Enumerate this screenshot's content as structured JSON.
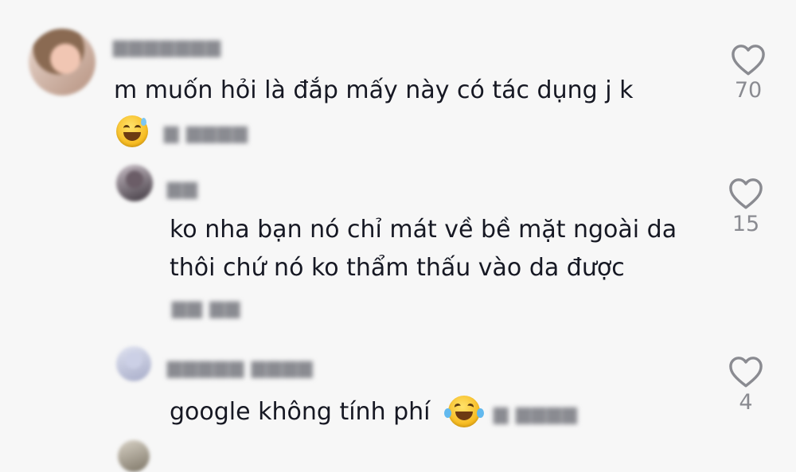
{
  "comments": [
    {
      "text": "m muốn hỏi là đắp mấy này có tác dụng j k",
      "likes": "70",
      "emoji": "grinning-face-with-sweat"
    },
    {
      "line1": "ko nha bạn nó chỉ mát về bề mặt ngoài da",
      "line2": "thôi chứ nó ko thẩm thấu vào da được",
      "likes": "15"
    },
    {
      "text": "google không tính phí",
      "likes": "4",
      "emoji": "face-with-tears-of-joy"
    }
  ],
  "icons": {
    "like": "heart-outline-icon"
  },
  "colors": {
    "background": "#f7f7f7",
    "text": "#161823",
    "muted": "#8a8b91"
  }
}
